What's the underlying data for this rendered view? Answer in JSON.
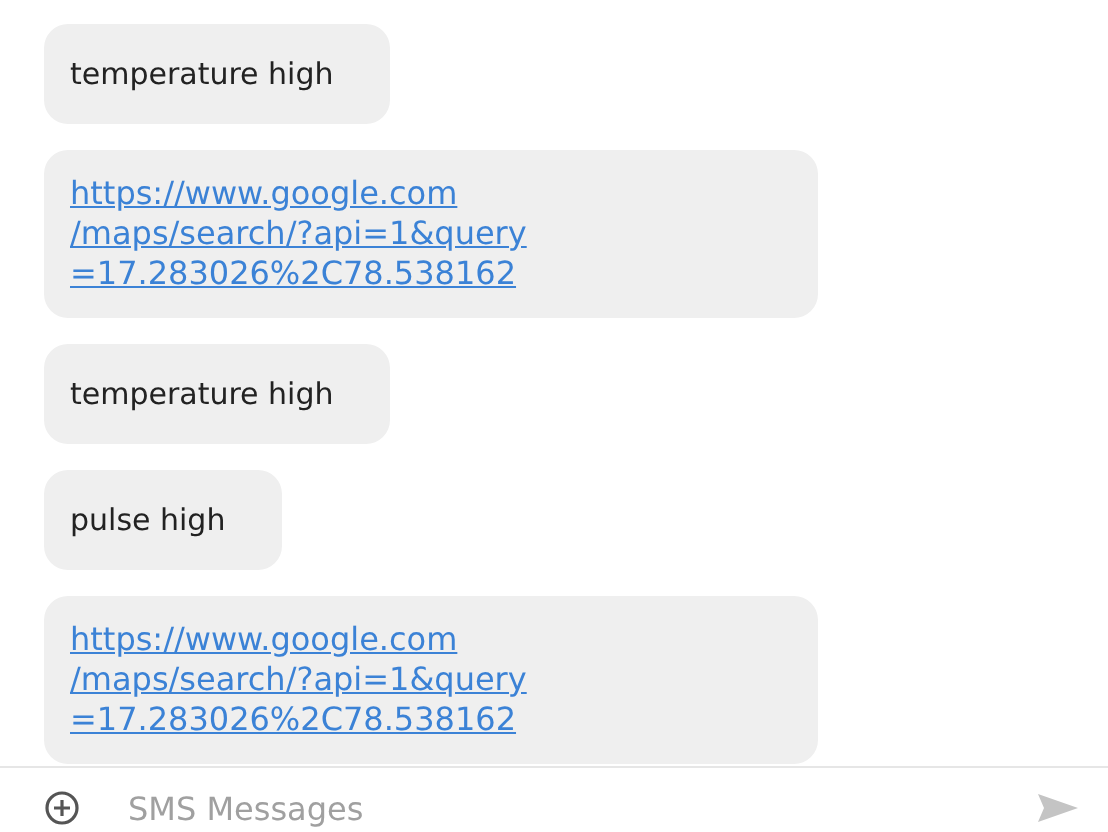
{
  "messages": [
    {
      "kind": "text",
      "lines": [
        "temperature high"
      ]
    },
    {
      "kind": "link",
      "lines": [
        "https://www.google.com",
        "/maps/search/?api=1&query",
        "=17.283026%2C78.538162"
      ]
    },
    {
      "kind": "text",
      "lines": [
        "temperature high"
      ]
    },
    {
      "kind": "text",
      "lines": [
        "pulse high"
      ]
    },
    {
      "kind": "link",
      "lines": [
        "https://www.google.com",
        "/maps/search/?api=1&query",
        "=17.283026%2C78.538162"
      ]
    }
  ],
  "composer": {
    "placeholder": "SMS Messages"
  }
}
